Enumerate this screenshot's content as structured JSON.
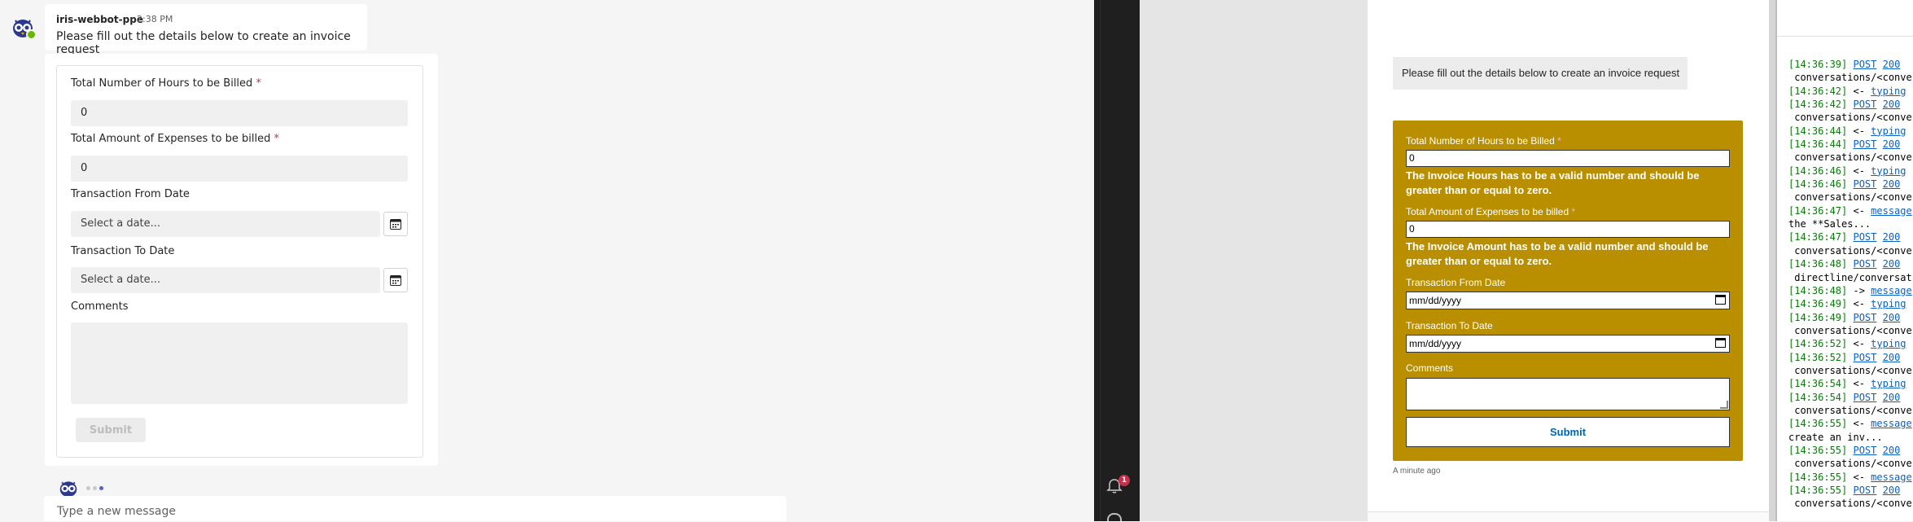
{
  "teams": {
    "sender": "iris-webbot-ppe",
    "time": "2:38 PM",
    "message": "Please fill out the details below to create an invoice request",
    "card": {
      "hours_label": "Total Number of Hours to be Billed",
      "hours_value": "0",
      "expenses_label": "Total Amount of Expenses to be billed",
      "expenses_value": "0",
      "from_label": "Transaction From Date",
      "from_placeholder": "Select a date...",
      "to_label": "Transaction To Date",
      "to_placeholder": "Select a date...",
      "comments_label": "Comments",
      "submit_label": "Submit",
      "required_mark": "*"
    },
    "compose_placeholder": "Type a new message"
  },
  "rail": {
    "bell_badge": "1"
  },
  "webchat": {
    "message": "Please fill out the details below to create an invoice request",
    "card": {
      "hours_label": "Total Number of Hours to be Billed",
      "hours_value": "0",
      "hours_error": "The Invoice Hours has to be a valid number and should be greater than or equal to zero.",
      "expenses_label": "Total Amount of Expenses to be billed",
      "expenses_value": "0",
      "expenses_error": "The Invoice Amount has to be a valid number and should be greater than or equal to zero.",
      "from_label": "Transaction From Date",
      "from_placeholder": "mm/dd/yyyy",
      "to_label": "Transaction To Date",
      "to_placeholder": "mm/dd/yyyy",
      "comments_label": "Comments",
      "submit_label": "Submit",
      "required_mark": "*",
      "background_color": "#b98f00"
    },
    "timestamp": "A minute ago"
  },
  "log": {
    "lines": [
      {
        "ts": "[14:36:39]",
        "arrow": "",
        "link": "POST",
        "code": "200"
      },
      {
        "text": " conversations/<conve"
      },
      {
        "ts": "[14:36:42]",
        "arrow": " <- ",
        "link": "typing",
        "code": ""
      },
      {
        "ts": "[14:36:42]",
        "arrow": "",
        "link": "POST",
        "code": "200"
      },
      {
        "text": " conversations/<conve"
      },
      {
        "ts": "[14:36:44]",
        "arrow": " <- ",
        "link": "typing",
        "code": ""
      },
      {
        "ts": "[14:36:44]",
        "arrow": "",
        "link": "POST",
        "code": "200"
      },
      {
        "text": " conversations/<conve"
      },
      {
        "ts": "[14:36:46]",
        "arrow": " <- ",
        "link": "typing",
        "code": ""
      },
      {
        "ts": "[14:36:46]",
        "arrow": "",
        "link": "POST",
        "code": "200"
      },
      {
        "text": " conversations/<conve"
      },
      {
        "ts": "[14:36:47]",
        "arrow": " <- ",
        "link": "message",
        "code": ""
      },
      {
        "text": "the **Sales..."
      },
      {
        "ts": "[14:36:47]",
        "arrow": "",
        "link": "POST",
        "code": "200"
      },
      {
        "text": " conversations/<conve"
      },
      {
        "ts": "[14:36:48]",
        "arrow": "",
        "link": "POST",
        "code": "200"
      },
      {
        "text": " directline/conversat"
      },
      {
        "ts": "[14:36:48]",
        "arrow": " -> ",
        "link": "message",
        "code": ""
      },
      {
        "ts": "[14:36:49]",
        "arrow": " <- ",
        "link": "typing",
        "code": ""
      },
      {
        "ts": "[14:36:49]",
        "arrow": "",
        "link": "POST",
        "code": "200"
      },
      {
        "text": " conversations/<conve"
      },
      {
        "ts": "[14:36:52]",
        "arrow": " <- ",
        "link": "typing",
        "code": ""
      },
      {
        "ts": "[14:36:52]",
        "arrow": "",
        "link": "POST",
        "code": "200"
      },
      {
        "text": " conversations/<conve"
      },
      {
        "ts": "[14:36:54]",
        "arrow": " <- ",
        "link": "typing",
        "code": ""
      },
      {
        "ts": "[14:36:54]",
        "arrow": "",
        "link": "POST",
        "code": "200"
      },
      {
        "text": " conversations/<conve"
      },
      {
        "ts": "[14:36:55]",
        "arrow": " <- ",
        "link": "message",
        "code": ""
      },
      {
        "text": "create an inv..."
      },
      {
        "ts": "[14:36:55]",
        "arrow": "",
        "link": "POST",
        "code": "200"
      },
      {
        "text": " conversations/<conve"
      },
      {
        "ts": "[14:36:55]",
        "arrow": " <- ",
        "link": "message",
        "code": ""
      },
      {
        "ts": "[14:36:55]",
        "arrow": "",
        "link": "POST",
        "code": "200"
      },
      {
        "text": " conversations/<conve"
      }
    ]
  }
}
